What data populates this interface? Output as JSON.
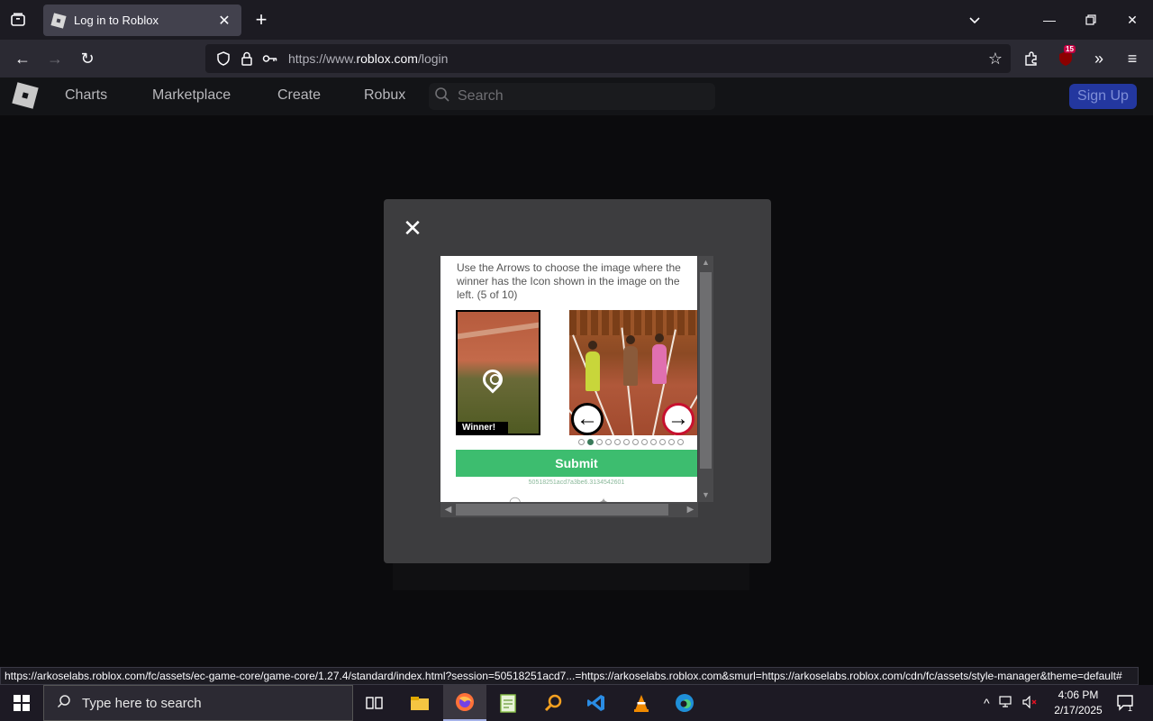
{
  "browser": {
    "tab_title": "Log in to Roblox",
    "url_prefix": "https://www.",
    "url_host": "roblox.com",
    "url_path": "/login",
    "extension_badge": "15"
  },
  "roblox": {
    "nav": [
      "Charts",
      "Marketplace",
      "Create",
      "Robux"
    ],
    "search_placeholder": "Search",
    "signup_label": "Sign Up"
  },
  "captcha": {
    "instructions": "Use the Arrows to choose the image where the winner has the Icon shown in the image on the left. (5 of 10)",
    "reference_label": "Winner!",
    "progress": {
      "current": 2,
      "total": 12
    },
    "submit_label": "Submit",
    "session_id": "50518251acd7a3be6.3134542601"
  },
  "status_bar": {
    "url": "https://arkoselabs.roblox.com/fc/assets/ec-game-core/game-core/1.27.4/standard/index.html?session=50518251acd7...=https://arkoselabs.roblox.com&smurl=https://arkoselabs.roblox.com/cdn/fc/assets/style-manager&theme=default#"
  },
  "taskbar": {
    "search_placeholder": "Type here to search",
    "time": "4:06 PM",
    "date": "2/17/2025",
    "notification_count": "1"
  },
  "colors": {
    "submit": "#3dbd6f",
    "signup": "#23379f",
    "badge": "#c50042"
  }
}
